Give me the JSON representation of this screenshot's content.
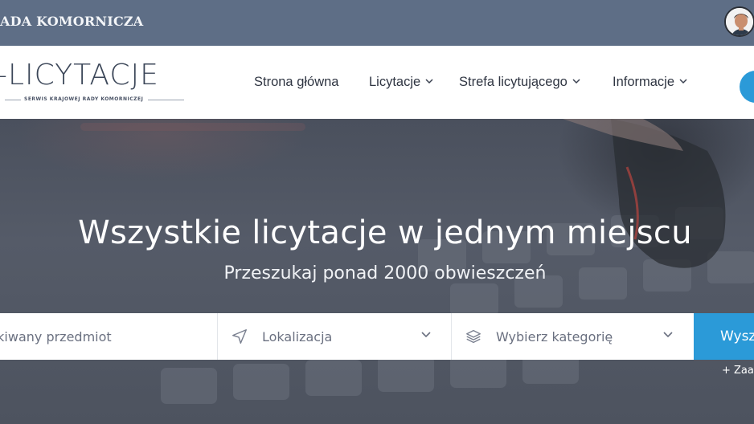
{
  "topbar": {
    "org_name": "ADA KOMORNICZA",
    "avatar_alt": "user-avatar"
  },
  "header": {
    "logo": {
      "main": "-LICYTACJE",
      "sub": "SERWIS KRAJOWEJ RADY KOMORNICZEJ"
    },
    "nav": [
      {
        "label": "Strona główna",
        "has_dropdown": false
      },
      {
        "label": "Licytacje",
        "has_dropdown": true
      },
      {
        "label": "Strefa licytującego",
        "has_dropdown": true
      },
      {
        "label": "Informacje",
        "has_dropdown": true
      }
    ]
  },
  "hero": {
    "title": "Wszystkie licytacje w jednym miejscu",
    "subtitle": "Przeszukaj ponad 2000 obwieszczeń"
  },
  "search": {
    "item_placeholder": "ukiwany przedmiot",
    "location_placeholder": "Lokalizacja",
    "category_placeholder": "Wybierz kategorię",
    "button_label": "Wysz",
    "advanced_label": "+  Zaa"
  },
  "icons": {
    "location": "navigation-arrow-icon",
    "category": "layers-icon",
    "dropdown": "chevron-down-icon"
  },
  "colors": {
    "topbar_bg": "#5e6e86",
    "accent": "#2b9ad8",
    "nav_text": "#2f3542"
  }
}
